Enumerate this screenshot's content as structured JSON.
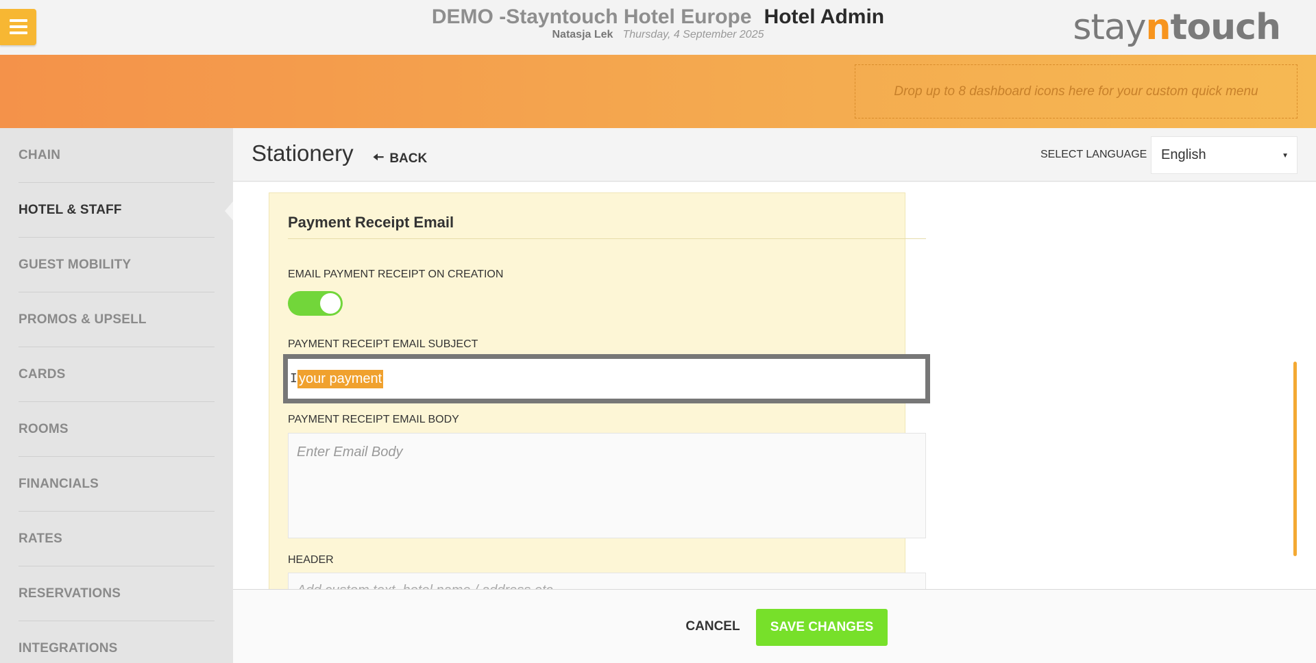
{
  "header": {
    "hotel_name": "DEMO -Stayntouch Hotel Europe",
    "app_name": "Hotel Admin",
    "user": "Natasja Lek",
    "date": "Thursday, 4 September 2025",
    "logo": {
      "part1": "stay",
      "part2": "n",
      "part3": "touch"
    }
  },
  "quick_menu": {
    "placeholder": "Drop up to 8 dashboard icons here for your custom quick menu"
  },
  "sidebar": {
    "items": [
      {
        "label": "CHAIN"
      },
      {
        "label": "HOTEL & STAFF",
        "active": true
      },
      {
        "label": "GUEST MOBILITY"
      },
      {
        "label": "PROMOS & UPSELL"
      },
      {
        "label": "CARDS"
      },
      {
        "label": "ROOMS"
      },
      {
        "label": "FINANCIALS"
      },
      {
        "label": "RATES"
      },
      {
        "label": "RESERVATIONS"
      },
      {
        "label": "INTEGRATIONS"
      }
    ]
  },
  "page": {
    "title": "Stationery",
    "back_label": "BACK",
    "language_label": "SELECT LANGUAGE",
    "language_value": "English"
  },
  "card": {
    "title": "Payment Receipt Email",
    "toggle_label": "EMAIL PAYMENT RECEIPT ON CREATION",
    "toggle_on": true,
    "subject_label": "PAYMENT RECEIPT EMAIL SUBJECT",
    "subject_value": "your payment",
    "body_label": "PAYMENT RECEIPT EMAIL BODY",
    "body_placeholder": "Enter Email Body",
    "header_label": "HEADER",
    "header_placeholder": "Add custom text, hotel name / address etc."
  },
  "footer": {
    "cancel_label": "CANCEL",
    "save_label": "SAVE CHANGES"
  },
  "colors": {
    "accent_orange": "#f4a94f",
    "toggle_on": "#72d63a",
    "save_button": "#77e02a",
    "selection": "#f0a12e"
  }
}
